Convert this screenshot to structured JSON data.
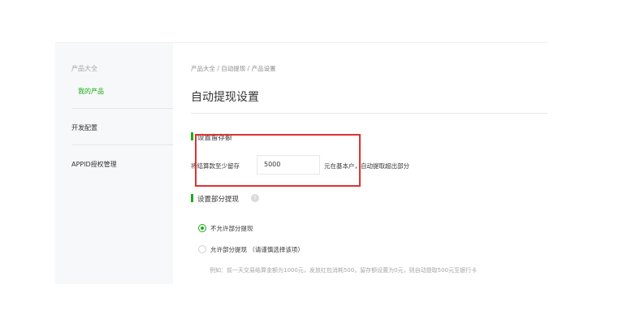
{
  "sidebar": {
    "group_title": "产品大全",
    "active_item": "我的产品",
    "items": [
      "开发配置",
      "APPID授权管理"
    ]
  },
  "breadcrumb": "产品大全 / 自动提现 / 产品设置",
  "page_title": "自动提现设置",
  "reserve_section": {
    "title": "设置留存额",
    "prefix_text": "将结算款至少留存",
    "amount_value": "5000",
    "suffix_text": "元在基本户，自动提取超出部分"
  },
  "partial_section": {
    "title": "设置部分提现",
    "help_icon": "question-circle-icon",
    "options": [
      {
        "label": "不允许部分提现",
        "checked": true
      },
      {
        "label": "允许部分提现 （请谨慎选择该项）",
        "checked": false
      }
    ],
    "example": "例如：前一天交易结算金额为1000元，发放红包消耗500，留存额设置为0元，则自动提取500元至银行卡"
  },
  "colors": {
    "accent": "#1aad19",
    "highlight": "#e03131",
    "sidebar_bg": "#f6f8f9"
  }
}
